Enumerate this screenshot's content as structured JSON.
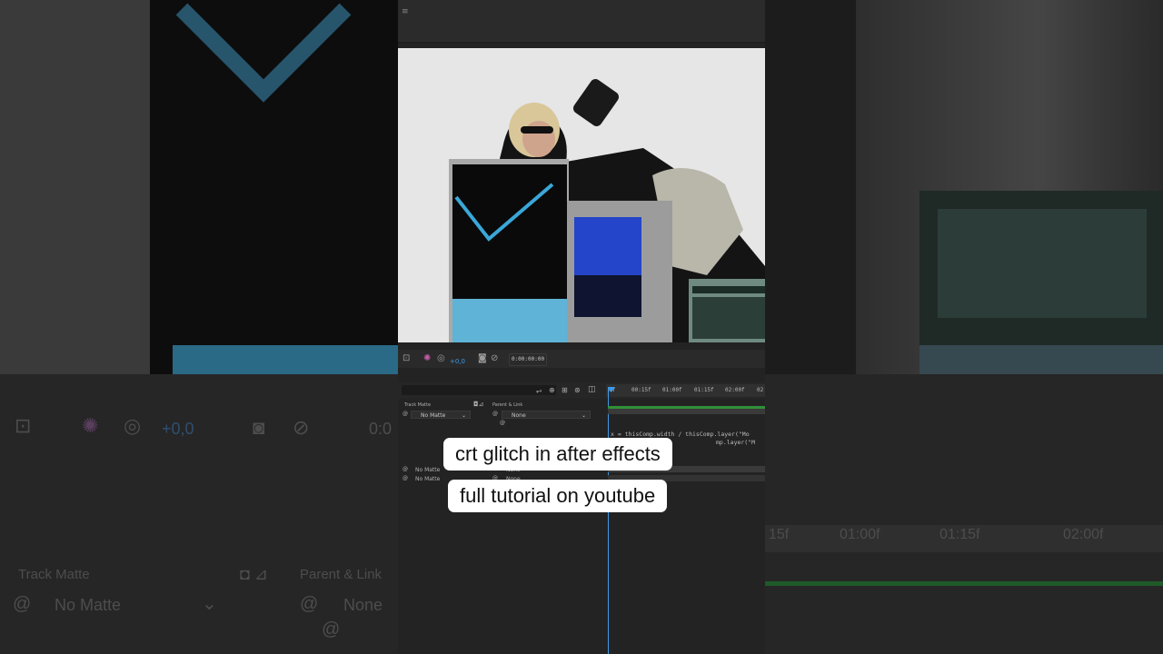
{
  "viewer_toolbar": {
    "exposure_value": "+0,0",
    "timecode": "0:00:00:00"
  },
  "timeline": {
    "ruler_ticks": [
      "0f",
      "00:15f",
      "01:00f",
      "01:15f",
      "02:00f",
      "02"
    ],
    "columns": {
      "track_matte": "Track Matte",
      "parent_link": "Parent & Link"
    },
    "layers": [
      {
        "matte": "No Matte",
        "parent": "None"
      },
      {
        "matte": "No Matte",
        "parent": "None"
      },
      {
        "matte": "No Matte",
        "parent": "None"
      }
    ],
    "expression_lines": [
      "x = thisComp.width / thisComp.layer(\"Mo",
      "mp.layer(\"M"
    ]
  },
  "captions": {
    "line1": "crt glitch in after effects",
    "line2": "full tutorial on youtube"
  },
  "background": {
    "exposure_value": "+0,0",
    "timecode_partial": "0:0",
    "track_matte": "Track Matte",
    "parent_link": "Parent & Link",
    "matte": "No Matte",
    "parent": "None",
    "ruler_ticks": [
      "15f",
      "01:00f",
      "01:15f",
      "02:00f"
    ]
  },
  "colors": {
    "accent_blue": "#3d9ae8",
    "green_bar": "#2f8f3a",
    "panel_bg": "#232323",
    "caption_bg": "#ffffff"
  }
}
